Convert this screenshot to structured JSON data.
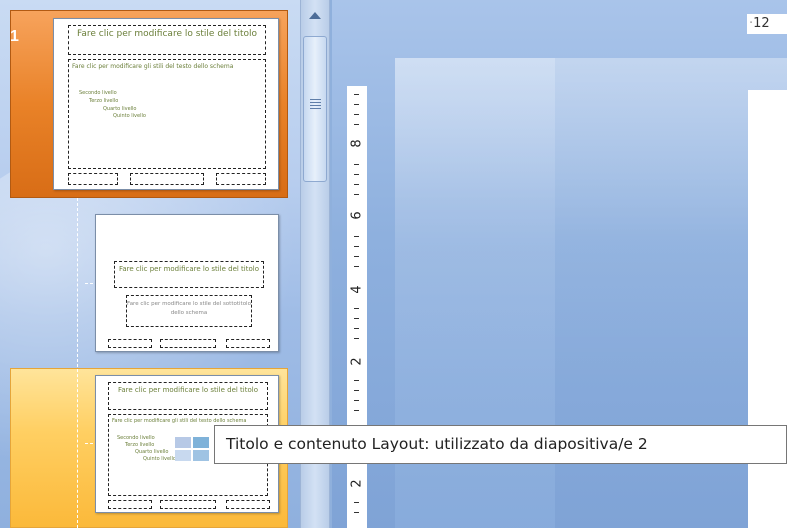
{
  "panel": {
    "slides": [
      {
        "number": "1",
        "title": "Fare clic per modificare lo stile del titolo",
        "body": "Fare clic per modificare gli stili del testo dello schema",
        "levels": [
          "Secondo livello",
          "Terzo livello",
          "Quarto livello",
          "Quinto livello"
        ]
      },
      {
        "title": "Fare clic per modificare lo stile del titolo",
        "subtitle": "Fare clic per modificare lo stile del sottotitolo dello schema"
      },
      {
        "title": "Fare clic per modificare lo stile del titolo",
        "body": "Fare clic per modificare gli stili del testo dello schema",
        "levels": [
          "Secondo livello",
          "Terzo livello",
          "Quarto livello",
          "Quinto livello"
        ]
      }
    ]
  },
  "ruler": {
    "horizontal_label": "12",
    "vertical_labels": [
      "8",
      "6",
      "4",
      "2",
      "2"
    ]
  },
  "tooltip": {
    "text": "Titolo e contenuto Layout: utilizzato da diapositiva/e 2"
  },
  "colors": {
    "master_selected": "#e98228",
    "hover_highlight": "#ffcf62",
    "background": "#8fb0dc"
  }
}
